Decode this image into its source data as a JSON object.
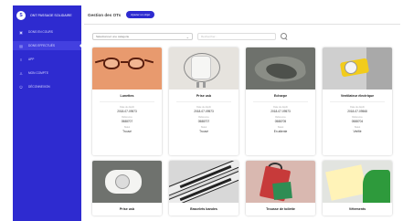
{
  "app": {
    "name": "ONT PASSAGE SOLIDAIRE"
  },
  "sidebar": {
    "items": [
      {
        "label": "DONS EN COURS",
        "icon": "box-icon"
      },
      {
        "label": "DONS EFFECTUÉS",
        "icon": "history-icon"
      },
      {
        "label": "APP",
        "icon": "list-icon"
      },
      {
        "label": "MON COMPTE",
        "icon": "user-icon"
      },
      {
        "label": "DÉCONNEXION",
        "icon": "power-icon"
      }
    ]
  },
  "header": {
    "title": "Gestion des OTs",
    "button_label": "Ajouter un objet"
  },
  "filters": {
    "select_value": "Sélectionnez une catégorie",
    "search_placeholder": "Rechercher..."
  },
  "cards": [
    {
      "title": "Lunettes",
      "date_label": "Date de dépôt",
      "date": "2018-07-09573",
      "ref_label": "Référence",
      "ref": "0588707",
      "status_label": "Statut",
      "status": "Trouvé"
    },
    {
      "title": "Prise usb",
      "date_label": "Date de dépôt",
      "date": "2018-07-09573",
      "ref_label": "Référence",
      "ref": "0588707",
      "status_label": "Statut",
      "status": "Trouvé"
    },
    {
      "title": "Echarpe",
      "date_label": "Date de dépôt",
      "date": "2018-07-09573",
      "ref_label": "Référence",
      "ref": "0588705",
      "status_label": "Statut",
      "status": "En attente"
    },
    {
      "title": "Ventilateur électrique",
      "date_label": "Date de dépôt",
      "date": "2018-07-09568",
      "ref_label": "Référence",
      "ref": "0588704",
      "status_label": "Statut",
      "status": "Vérifié"
    },
    {
      "title": "Prise usb"
    },
    {
      "title": "Bracelets bandes"
    },
    {
      "title": "Trousse de toilette"
    },
    {
      "title": "Vêtements"
    }
  ],
  "colors": {
    "sidebar": "#2e2bd0",
    "accent": "#2e2bd0"
  }
}
